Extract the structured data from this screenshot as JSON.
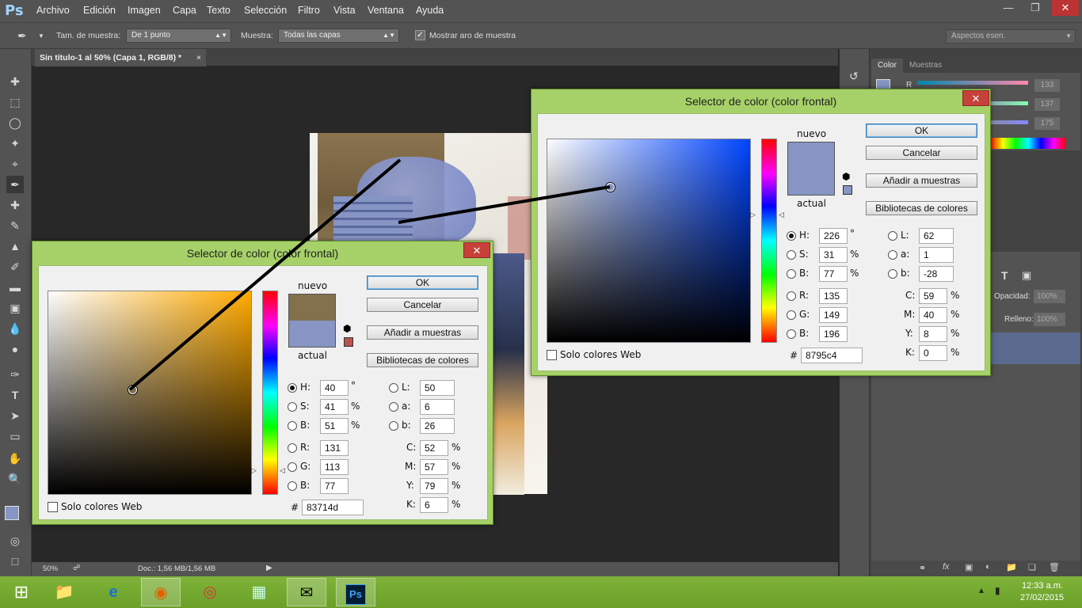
{
  "app": {
    "logo": "Ps"
  },
  "menu": [
    "Archivo",
    "Edición",
    "Imagen",
    "Capa",
    "Texto",
    "Selección",
    "Filtro",
    "Vista",
    "Ventana",
    "Ayuda"
  ],
  "options": {
    "sample_size_label": "Tam. de muestra:",
    "sample_size_value": "De 1 punto",
    "sample_label": "Muestra:",
    "sample_value": "Todas las capas",
    "show_ring_label": "Mostrar aro de muestra",
    "workspace": "Aspectos esen."
  },
  "document": {
    "tab_title": "Sin título-1 al 50% (Capa 1, RGB/8) *",
    "zoom": "50%",
    "doc_size": "Doc.: 1,56 MB/1,56 MB"
  },
  "color_panel": {
    "tabs": [
      "Color",
      "Muestras"
    ],
    "r": "133",
    "g": "137",
    "b": "175"
  },
  "layers_panel": {
    "opacity_label": "Opacidad:",
    "opacity_value": "100%",
    "fill_label": "Relleno:",
    "fill_value": "100%"
  },
  "dialog_left": {
    "title": "Selector de color (color frontal)",
    "new_label": "nuevo",
    "current_label": "actual",
    "new_color": "#83714d",
    "current_color": "#8795c4",
    "buttons": {
      "ok": "OK",
      "cancel": "Cancelar",
      "add": "Añadir a muestras",
      "libraries": "Bibliotecas de colores"
    },
    "web_only": "Solo colores Web",
    "H": "40",
    "S": "41",
    "Bv": "51",
    "R": "131",
    "G": "113",
    "B": "77",
    "L": "50",
    "a": "6",
    "b": "26",
    "C": "52",
    "M": "57",
    "Y": "79",
    "K": "6",
    "hex": "83714d",
    "hue_color": "#ffaa00"
  },
  "dialog_right": {
    "title": "Selector de color (color frontal)",
    "new_label": "nuevo",
    "current_label": "actual",
    "new_color": "#8795c4",
    "current_color": "#8795c4",
    "buttons": {
      "ok": "OK",
      "cancel": "Cancelar",
      "add": "Añadir a muestras",
      "libraries": "Bibliotecas de colores"
    },
    "web_only": "Solo colores Web",
    "H": "226",
    "S": "31",
    "Bv": "77",
    "R": "135",
    "G": "149",
    "B": "196",
    "L": "62",
    "a": "1",
    "b": "-28",
    "C": "59",
    "M": "40",
    "Y": "8",
    "K": "0",
    "hex": "8795c4",
    "hue_color": "#0044ff"
  },
  "field_labels": {
    "H": "H:",
    "S": "S:",
    "Bv": "B:",
    "R": "R:",
    "G": "G:",
    "B": "B:",
    "L": "L:",
    "a": "a:",
    "b": "b:",
    "C": "C:",
    "M": "M:",
    "Y": "Y:",
    "K": "K:",
    "hash": "#",
    "deg": "°",
    "pct": "%"
  },
  "taskbar": {
    "time": "12:33 a.m.",
    "date": "27/02/2015",
    "ps": "Ps"
  }
}
